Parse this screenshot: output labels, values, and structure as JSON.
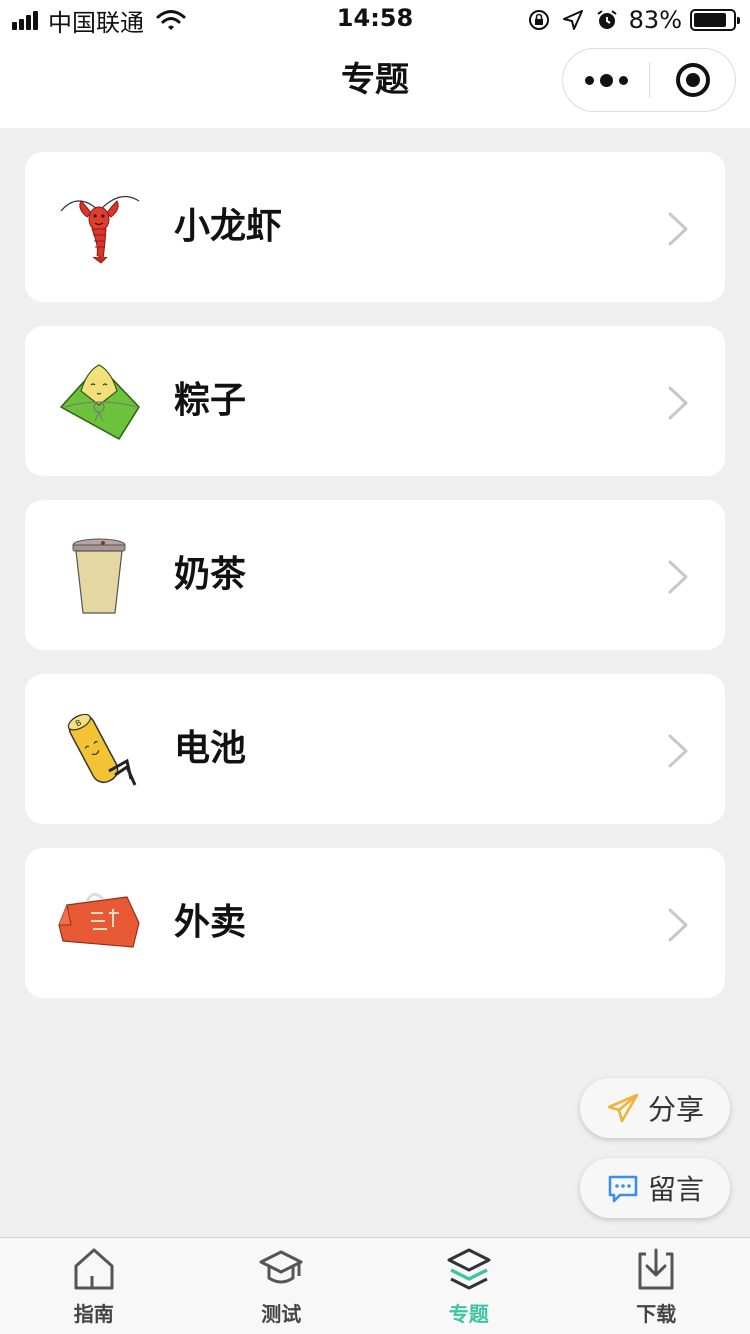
{
  "status_bar": {
    "carrier": "中国联通",
    "time": "14:58",
    "battery_percent": "83%",
    "battery_level": 0.83
  },
  "nav": {
    "title": "专题"
  },
  "topics": [
    {
      "label": "小龙虾",
      "icon": "crayfish-icon"
    },
    {
      "label": "粽子",
      "icon": "zongzi-icon"
    },
    {
      "label": "奶茶",
      "icon": "milk-tea-icon"
    },
    {
      "label": "电池",
      "icon": "battery-character-icon"
    },
    {
      "label": "外卖",
      "icon": "takeout-bag-icon"
    }
  ],
  "floating": {
    "share_label": "分享",
    "message_label": "留言"
  },
  "tabs": [
    {
      "label": "指南",
      "icon": "home-icon",
      "active": false
    },
    {
      "label": "测试",
      "icon": "graduation-cap-icon",
      "active": false
    },
    {
      "label": "专题",
      "icon": "layers-icon",
      "active": true
    },
    {
      "label": "下载",
      "icon": "download-icon",
      "active": false
    }
  ],
  "colors": {
    "accent": "#3cc5a0",
    "background": "#efefef",
    "share_icon": "#f0b23a",
    "message_icon": "#3b8ff0"
  }
}
